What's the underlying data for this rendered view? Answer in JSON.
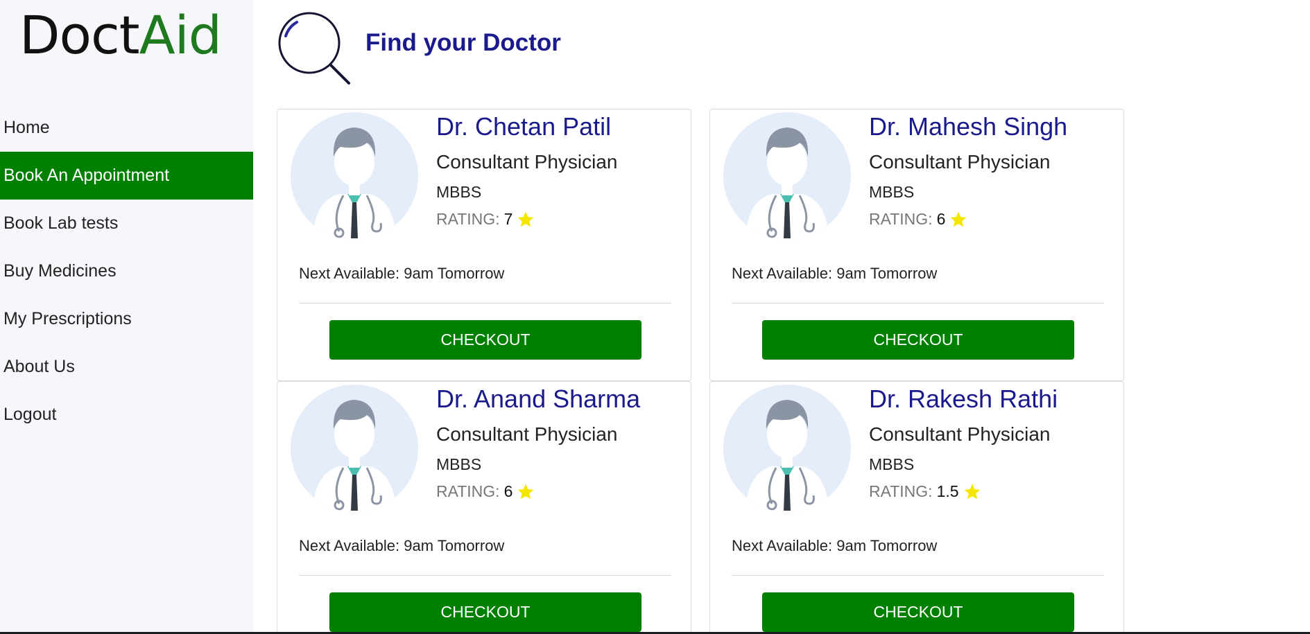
{
  "logo": {
    "part1": "Doct",
    "part2": "Aid"
  },
  "nav": {
    "items": [
      {
        "label": "Home"
      },
      {
        "label": "Book An Appointment"
      },
      {
        "label": "Book Lab tests"
      },
      {
        "label": "Buy Medicines"
      },
      {
        "label": "My Prescriptions"
      },
      {
        "label": "About Us"
      },
      {
        "label": "Logout"
      }
    ],
    "active_index": 1
  },
  "header": {
    "title": "Find your Doctor",
    "icon": "search-icon"
  },
  "colors": {
    "accent_green": "#008000",
    "title_blue": "#1a1a8c",
    "star_yellow": "#f5e600",
    "sidebar_bg": "#f5f7fa"
  },
  "rating_label": "RATING:",
  "doctors": [
    {
      "name": "Dr. Chetan Patil",
      "role": "Consultant Physician",
      "degree": "MBBS",
      "rating": "7",
      "next_available": "Next Available: 9am Tomorrow",
      "button": "CHECKOUT"
    },
    {
      "name": "Dr. Mahesh Singh",
      "role": "Consultant Physician",
      "degree": "MBBS",
      "rating": "6",
      "next_available": "Next Available: 9am Tomorrow",
      "button": "CHECKOUT"
    },
    {
      "name": "Dr. Anand Sharma",
      "role": "Consultant Physician",
      "degree": "MBBS",
      "rating": "6",
      "next_available": "Next Available: 9am Tomorrow",
      "button": "CHECKOUT"
    },
    {
      "name": "Dr. Rakesh Rathi",
      "role": "Consultant Physician",
      "degree": "MBBS",
      "rating": "1.5",
      "next_available": "Next Available: 9am Tomorrow",
      "button": "CHECKOUT"
    }
  ]
}
